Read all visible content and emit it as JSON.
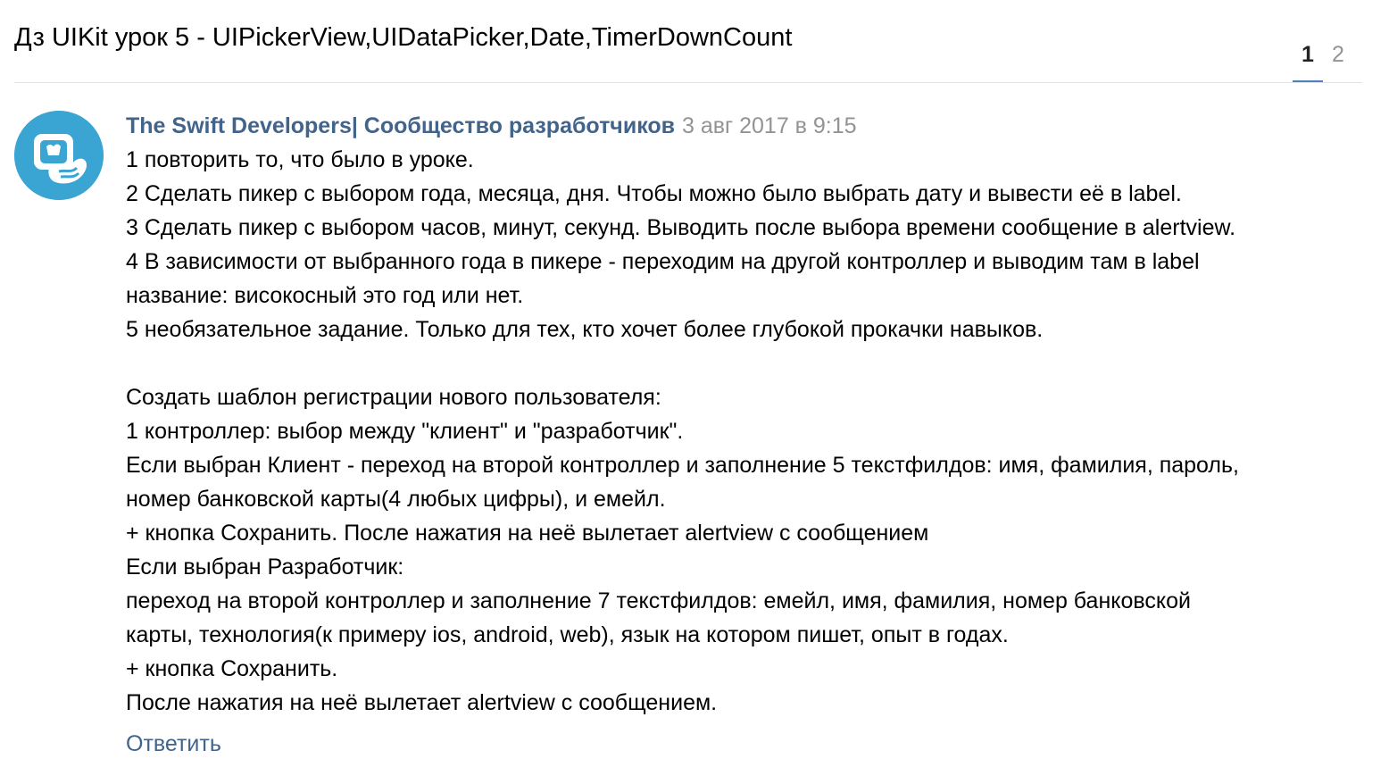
{
  "topic": {
    "title": "Дз UIKit урок 5 - UIPickerView,UIDataPicker,Date,TimerDownCount"
  },
  "pagination": {
    "pages": [
      "1",
      "2"
    ],
    "current": "1"
  },
  "post": {
    "author": "The Swift Developers| Сообщество разработчиков",
    "date": "3 авг 2017 в 9:15",
    "lines": [
      "1 повторить то, что было в уроке.",
      "2 Сделать пикер с выбором года, месяца, дня. Чтобы можно было выбрать дату и вывести её в label.",
      "3 Сделать пикер с выбором часов, минут, секунд. Выводить после выбора времени сообщение в alertview.",
      "4 В зависимости от выбранного года в пикере - переходим на другой контроллер и выводим там в label",
      "название: високосный это год или нет.",
      "5 необязательное задание. Только для тех, кто хочет более глубокой прокачки навыков.",
      "",
      "Создать шаблон регистрации нового пользователя:",
      "1 контроллер: выбор между \"клиент\" и \"разработчик\".",
      "Если выбран Клиент - переход на второй контроллер и заполнение 5 текстфилдов: имя, фамилия, пароль,",
      "номер банковской карты(4 любых цифры), и емейл.",
      "+ кнопка Сохранить. После нажатия на неё вылетает alertview с сообщением",
      "Если выбран Разработчик:",
      "переход на второй контроллер и заполнение 7 текстфилдов: емейл, имя, фамилия, номер банковской",
      "карты, технология(к примеру ios, android, web), язык на котором пишет, опыт в годах.",
      "+ кнопка Сохранить.",
      "После нажатия на неё вылетает alertview с сообщением."
    ],
    "reply_label": "Ответить"
  },
  "colors": {
    "link": "#42648b",
    "muted": "#939393",
    "accent": "#5181b8",
    "avatar_bg": "#3aa4d3"
  },
  "icons": {
    "avatar": "swift-hand-logo-icon"
  }
}
